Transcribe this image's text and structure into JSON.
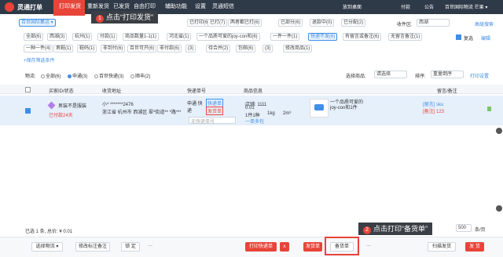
{
  "app": {
    "title": "灵通打单"
  },
  "nav": {
    "print": "打印发货",
    "reprint": "重新发货",
    "shipped": "已发货",
    "free_print": "自由打印",
    "assist": "辅助功能",
    "settings": "设置",
    "sms": "灵通短信"
  },
  "topbar": {
    "desktop": "放到桌面",
    "free": "付款",
    "notice": "公告",
    "user": "百世国际物流 芒果 ▾"
  },
  "callout1": {
    "num": "1",
    "text": "点击“打印发货”"
  },
  "callout2": {
    "num": "2",
    "text": "点击打印“备货单”"
  },
  "filters": {
    "shop": "百世国际集运 ▾",
    "row1": [
      "全部(6)",
      "未付款(0)",
      "已付款",
      "",
      "已打印(6)",
      "已打(7)",
      "两者都已打(6)",
      "已部分(6)",
      "退款中(0)",
      "已分配(2)"
    ],
    "receiver_label": "收件区:",
    "receiver_value": "西湖",
    "adv_search": "高级搜索",
    "row2": [
      "全部(6)",
      "西湖(3)",
      "杭州(1)",
      "付款(1)",
      "商品数量1-1(1)",
      "河北省(1)",
      "一个品质可爱的joy-con和(6)",
      "一件一件(1)",
      "快递不发(6)",
      "有留言或备注(6)",
      "无留言备注(1)"
    ],
    "repeat": "复选",
    "edit": "编辑",
    "row3": [
      "一种一件(4)",
      "男鞋(1)",
      "鞋码(1)",
      "非到付(6)",
      "百世可开(6)",
      "非付款(6)",
      "(3)",
      "待合并(2)",
      "包邮(6)",
      "(3)",
      "修改商品(1)"
    ],
    "save_filter": "+保存筛选条件"
  },
  "logistics": {
    "label": "物流:",
    "options": [
      "全部(6)",
      "申通(3)",
      "百世快递(3)",
      "顺丰(2)"
    ],
    "select_goods": "选择商品:",
    "select_placeholder": "请选择",
    "sort_label": "排序:",
    "sort_value": "重量倒序",
    "print_settings": "打印设置"
  },
  "table": {
    "headers": [
      "买家ID/状态",
      "收货地址",
      "快递单号",
      "商品信息",
      "留言/备注"
    ],
    "row": {
      "buyer": "男装不是服装",
      "status": "已付款24天",
      "address_name": "小* *******2476",
      "address_line": "浙江省 杭州市 西湖区 翠*街道** *路*** 前*...",
      "courier": "申通 快递",
      "tag1": "快递单",
      "tag2": "发货单",
      "tracking_placeholder": "无快递单号",
      "shop": "店铺: 1111",
      "count": "0.01",
      "qty_price": "1件1种",
      "weight": "1kg",
      "volume": "2m³",
      "merge": "一单多包",
      "goods_name": "一个品质可爱的joy-con和1件",
      "goods_qty": "1件",
      "memo1": "[留言] sku",
      "memo2": "[备注] 123"
    }
  },
  "pagination": {
    "size": "500",
    "unit": "条/页"
  },
  "footer": {
    "summary": "已选 1 条, 总价: ¥ 0.01",
    "choose_logistics": "选择物流 ▾",
    "modify_memo": "修改标注备注",
    "lock": "锁 定",
    "more": "···",
    "print_express": "打印快递单",
    "arrow": "∧",
    "ship": "发货单",
    "stock": "备货单",
    "stock_more": "···",
    "print_ship": "扫描发货",
    "ship_btn": "发 货"
  },
  "colors": {
    "accent": "#e8443a",
    "topbar": "#2f3a48",
    "blue": "#3f8ee8"
  }
}
